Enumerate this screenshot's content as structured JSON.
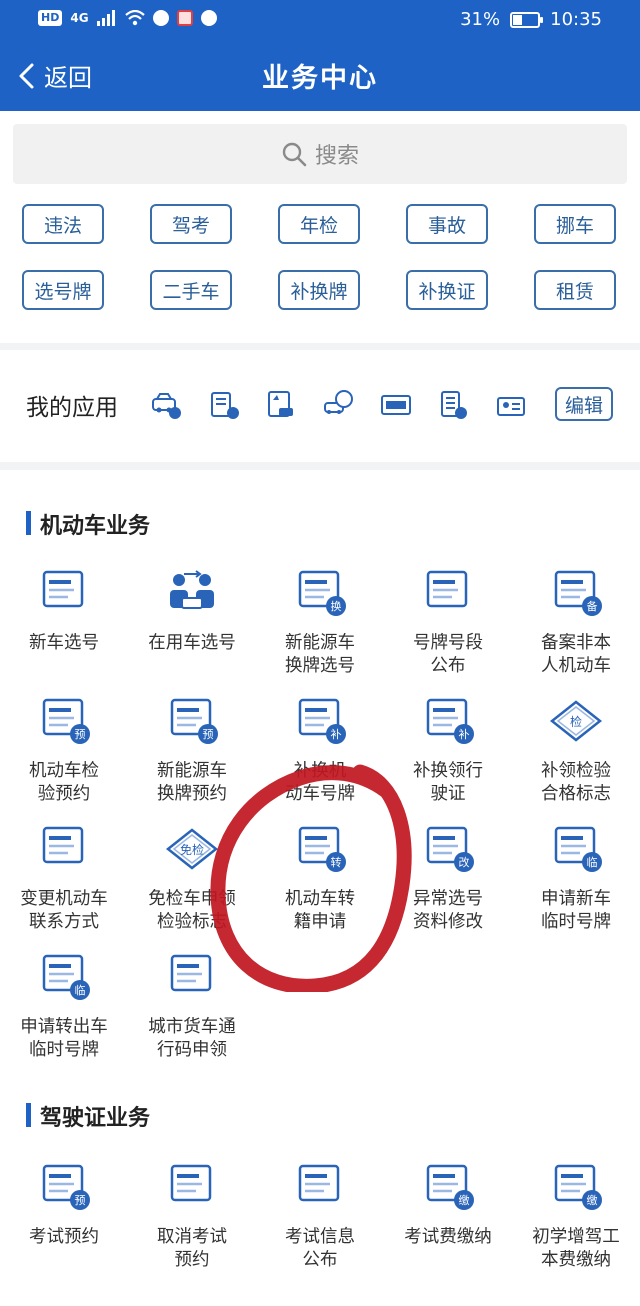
{
  "status_bar": {
    "network": "HD",
    "signal": "4G",
    "battery_text": "31%",
    "time": "10:35"
  },
  "nav": {
    "back_label": "返回",
    "title": "业务中心"
  },
  "search": {
    "placeholder": "搜索"
  },
  "quick_tags": [
    "违法",
    "驾考",
    "年检",
    "事故",
    "挪车",
    "选号牌",
    "二手车",
    "补换牌",
    "补换证",
    "租赁"
  ],
  "my_apps": {
    "title": "我的应用",
    "edit_label": "编辑",
    "icons": [
      "car-violation-icon",
      "document-icon",
      "vehicle-record-icon",
      "move-car-icon",
      "plate-icon",
      "list-icon",
      "card-icon"
    ]
  },
  "vehicle_section": {
    "title": "机动车业务",
    "items": [
      {
        "label": "新车选号",
        "icon": "new-car-plate-icon"
      },
      {
        "label": "在用车选号",
        "icon": "car-exchange-icon"
      },
      {
        "label": "新能源车\n换牌选号",
        "icon": "ev-plate-icon",
        "badge": "换"
      },
      {
        "label": "号牌号段\n公布",
        "icon": "plate-range-icon"
      },
      {
        "label": "备案非本\n人机动车",
        "icon": "record-car-icon",
        "badge": "备"
      },
      {
        "label": "机动车检\n验预约",
        "icon": "inspection-booking-icon",
        "badge": "预"
      },
      {
        "label": "新能源车\n换牌预约",
        "icon": "ev-plate-booking-icon",
        "badge": "预"
      },
      {
        "label": "补换机\n动车号牌",
        "icon": "replace-plate-icon",
        "badge": "补"
      },
      {
        "label": "补换领行\n驶证",
        "icon": "replace-license-icon",
        "badge": "补"
      },
      {
        "label": "补领检验\n合格标志",
        "icon": "inspection-mark-icon",
        "badge": "检"
      },
      {
        "label": "变更机动车\n联系方式",
        "icon": "change-contact-icon"
      },
      {
        "label": "免检车申领\n检验标志",
        "icon": "exempt-mark-icon",
        "badge": "免检"
      },
      {
        "label": "机动车转\n籍申请",
        "icon": "transfer-registry-icon",
        "badge": "转"
      },
      {
        "label": "异常选号\n资料修改",
        "icon": "abnormal-plate-icon",
        "badge": "改"
      },
      {
        "label": "申请新车\n临时号牌",
        "icon": "temp-plate-new-icon",
        "badge": "临"
      },
      {
        "label": "申请转出车\n临时号牌",
        "icon": "temp-plate-out-icon",
        "badge": "临"
      },
      {
        "label": "城市货车通\n行码申领",
        "icon": "truck-pass-icon"
      }
    ]
  },
  "license_section": {
    "title": "驾驶证业务",
    "items": [
      {
        "label": "考试预约",
        "icon": "exam-booking-icon",
        "badge": "预"
      },
      {
        "label": "取消考试\n预约",
        "icon": "cancel-exam-icon"
      },
      {
        "label": "考试信息\n公布",
        "icon": "exam-info-icon"
      },
      {
        "label": "考试费缴纳",
        "icon": "exam-fee-icon",
        "badge": "缴"
      },
      {
        "label": "初学增驾工\n本费缴纳",
        "icon": "license-fee-icon",
        "badge": "缴"
      }
    ]
  },
  "colors": {
    "header": "#1d62c4",
    "icon_blue": "#2a64b8",
    "annotation_red": "#c0161f"
  }
}
